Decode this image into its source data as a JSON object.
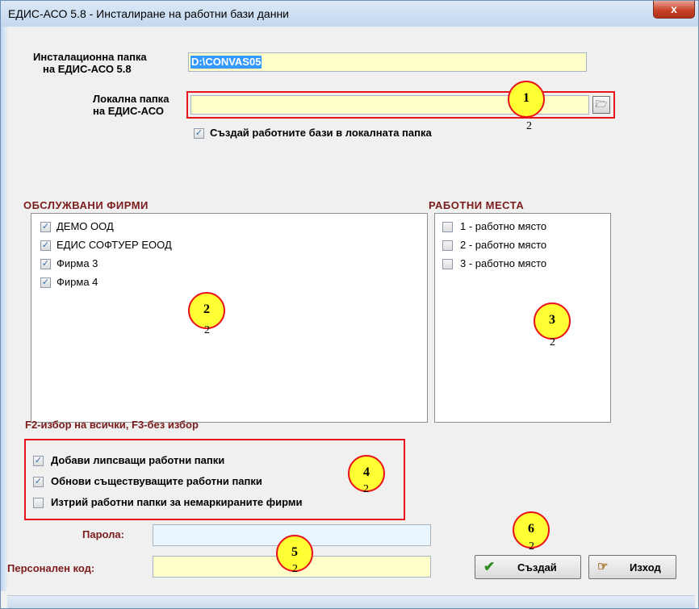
{
  "window": {
    "title": "ЕДИС-АСО 5.8 - Инсталиране на работни бази данни",
    "close_glyph": "x"
  },
  "install_folder": {
    "label_line1": "Инсталационна папка",
    "label_line2": "на ЕДИС-АСО 5.8",
    "value": "D:\\CONVAS05"
  },
  "local_folder": {
    "label_line1": "Локална папка",
    "label_line2": "на ЕДИС-АСО",
    "value": "",
    "browse_icon": "folder-open-icon"
  },
  "create_local_checkbox": {
    "label": "Създай работните бази в локалната папка",
    "checked": true
  },
  "firms": {
    "title": "ОБСЛУЖВАНИ ФИРМИ",
    "items": [
      {
        "label": "ДЕМО ООД",
        "checked": true
      },
      {
        "label": "ЕДИС СОФТУЕР ЕООД",
        "checked": true
      },
      {
        "label": "Фирма 3",
        "checked": true
      },
      {
        "label": "Фирма 4",
        "checked": true
      }
    ]
  },
  "workplaces": {
    "title": "РАБОТНИ МЕСТА",
    "items": [
      {
        "label": "1 - работно място",
        "checked": false
      },
      {
        "label": "2 - работно място",
        "checked": false
      },
      {
        "label": "3 - работно място",
        "checked": false
      }
    ]
  },
  "hint": "F2-избор на всички, F3-без избор",
  "options": [
    {
      "label": "Добави липсващи работни папки",
      "checked": true
    },
    {
      "label": "Обнови съществуващите работни папки",
      "checked": true
    },
    {
      "label": "Изтрий работни папки за немаркираните фирми",
      "checked": false
    }
  ],
  "password": {
    "label": "Парола:",
    "value": ""
  },
  "personal_code": {
    "label": "Персонален код:",
    "value": ""
  },
  "buttons": {
    "create": {
      "label": "Създай",
      "icon": "checkmark-icon",
      "color": "#2e8b1e"
    },
    "exit": {
      "label": "Изход",
      "icon": "pointing-hand-icon"
    }
  },
  "markers": [
    {
      "num": "1",
      "sub": "2"
    },
    {
      "num": "2",
      "sub": "2"
    },
    {
      "num": "3",
      "sub": "2"
    },
    {
      "num": "4",
      "sub": "2"
    },
    {
      "num": "5",
      "sub": "2"
    },
    {
      "num": "6",
      "sub": "2"
    }
  ],
  "colors": {
    "highlight_red": "#e8141b",
    "marker_yellow": "#ffff33",
    "section_title": "#7b1c1c",
    "field_yellow": "#ffffcc",
    "field_blue": "#eaf6fd"
  }
}
